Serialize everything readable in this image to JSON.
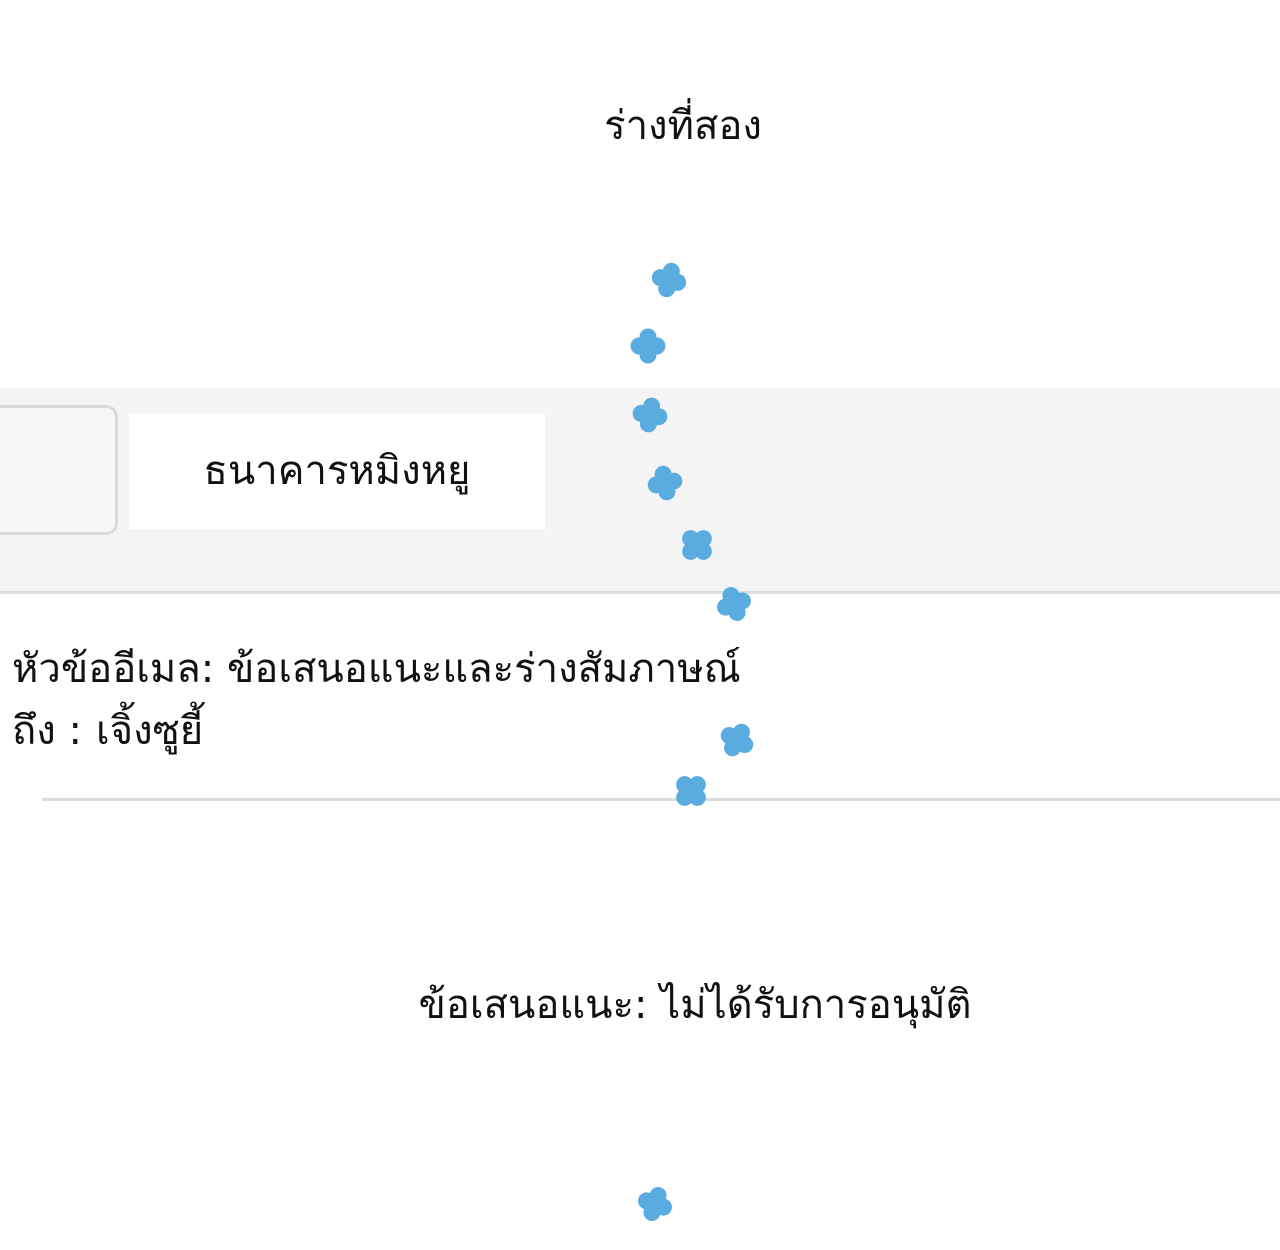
{
  "captions": {
    "top": "ร่างที่สอง",
    "bottom": "ข้อเสนอแนะ: ไม่ได้รับการอนุมัติ"
  },
  "email": {
    "sender_name": "ธนาคารหมิงหยู",
    "subject_line": "หัวข้ออีเมล: ข้อเสนอแนะและร่างสัมภาษณ์",
    "to_prefix": "ถึง :",
    "to_name": "เจิ้งซูยี้"
  },
  "decoration": {
    "icon": "flower-icon",
    "color": "#5aace0"
  },
  "colors": {
    "header_background": "#f4f4f4",
    "sender_box": "#ffffff",
    "text": "#111111"
  }
}
